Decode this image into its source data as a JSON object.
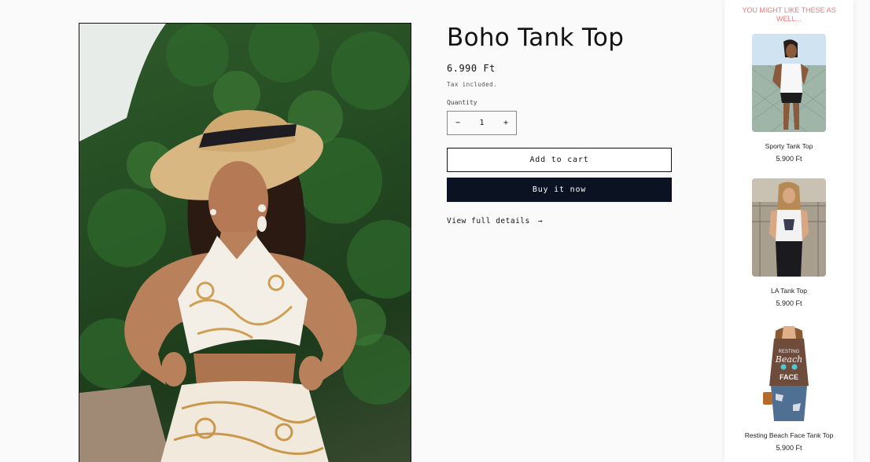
{
  "product": {
    "title": "Boho Tank Top",
    "price": "6.990 Ft",
    "tax_note": "Tax included.",
    "quantity_label": "Quantity",
    "quantity_value": "1",
    "decrement_symbol": "−",
    "increment_symbol": "+",
    "add_to_cart_label": "Add to cart",
    "buy_now_label": "Buy it now",
    "view_details_label": "View full details",
    "view_details_arrow": "→"
  },
  "recommendations": {
    "heading": "YOU MIGHT LIKE THESE AS WELL...",
    "items": [
      {
        "name": "Sporty Tank Top",
        "price": "5.900 Ft"
      },
      {
        "name": "LA Tank Top",
        "price": "5.900 Ft"
      },
      {
        "name": "Resting Beach Face Tank Top",
        "price": "5.900 Ft"
      }
    ]
  },
  "colors": {
    "accent_pink": "#e87b7b",
    "buy_button": "#0b1222"
  }
}
